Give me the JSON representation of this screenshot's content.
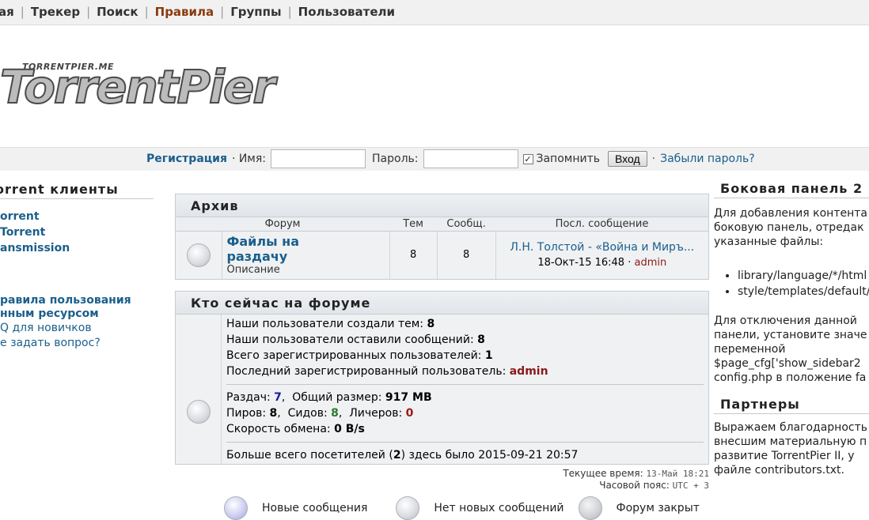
{
  "nav": {
    "items": [
      "ая",
      "Трекер",
      "Поиск",
      "Правила",
      "Группы",
      "Пользователи"
    ]
  },
  "logo": {
    "small": "TORRENTPIER.ME",
    "big": "TorrentPier"
  },
  "login": {
    "register": "Регистрация",
    "name_label": "· Имя:",
    "password_label": "Пароль:",
    "remember_label": "Запомнить",
    "login_button": "Вход",
    "forgot": "Забыли пароль?",
    "forgot_dot": "·"
  },
  "left": {
    "title": "orrent клиенты",
    "clients": [
      "orrent",
      "Torrent",
      "ansmission"
    ],
    "links": [
      "равила пользования",
      "нным ресурсом",
      "Q для новичков",
      "е задать вопрос?"
    ]
  },
  "archive": {
    "title": "Архив",
    "columns": [
      "Форум",
      "Тем",
      "Сообщ.",
      "Посл. сообщение"
    ],
    "forum": {
      "name": "Файлы на раздачу",
      "description": "Описание",
      "topics": "8",
      "posts": "8",
      "last_topic": "Л.Н. Толстой - «Война и Миръ...",
      "last_date": "18-Окт-15 16:48",
      "last_author": "admin"
    }
  },
  "online": {
    "title": "Кто сейчас на форуме",
    "topics_label": "Наши пользователи создали тем:",
    "topics": "8",
    "posts_label": "Наши пользователи оставили сообщений:",
    "posts": "8",
    "users_label": "Всего зарегистрированных пользователей:",
    "users": "1",
    "last_user_label": "Последний зарегистрированный пользователь:",
    "last_user": "admin",
    "torrents_label": "Раздач:",
    "torrents": "7",
    "size_label": "Общий размер:",
    "size": "917 MB",
    "peers_label": "Пиров:",
    "peers": "8",
    "seeds_label": "Сидов:",
    "seeds": "8",
    "leechers_label": "Личеров:",
    "leechers": "0",
    "speed_label": "Скорость обмена:",
    "speed": "0 B/s",
    "record_prefix": "Больше всего посетителей (",
    "record_count": "2",
    "record_suffix": ") здесь было 2015-09-21 20:57"
  },
  "time": {
    "current_label": "Текущее время:",
    "current": "13-Май 18:21",
    "tz_label": "Часовой пояс:",
    "tz": "UTC + 3"
  },
  "legend": {
    "new": "Новые сообщения",
    "nonew": "Нет новых сообщений",
    "locked": "Форум закрыт"
  },
  "right": {
    "title1": "Боковая панель 2",
    "p1": [
      "Для добавления контента",
      "боковую панель, отредак",
      "указанные файлы:"
    ],
    "files": [
      "library/language/*/html",
      "style/templates/default/"
    ],
    "p2": [
      "Для отключения данной",
      "панели, установите значе",
      "переменной",
      "$page_cfg['show_sidebar2",
      "config.php в положение fa"
    ],
    "title2": "Партнеры",
    "p3": [
      "Выражаем благодарность",
      "внесшим материальную п",
      "развитие TorrentPier II, у",
      "файле contributors.txt."
    ]
  }
}
